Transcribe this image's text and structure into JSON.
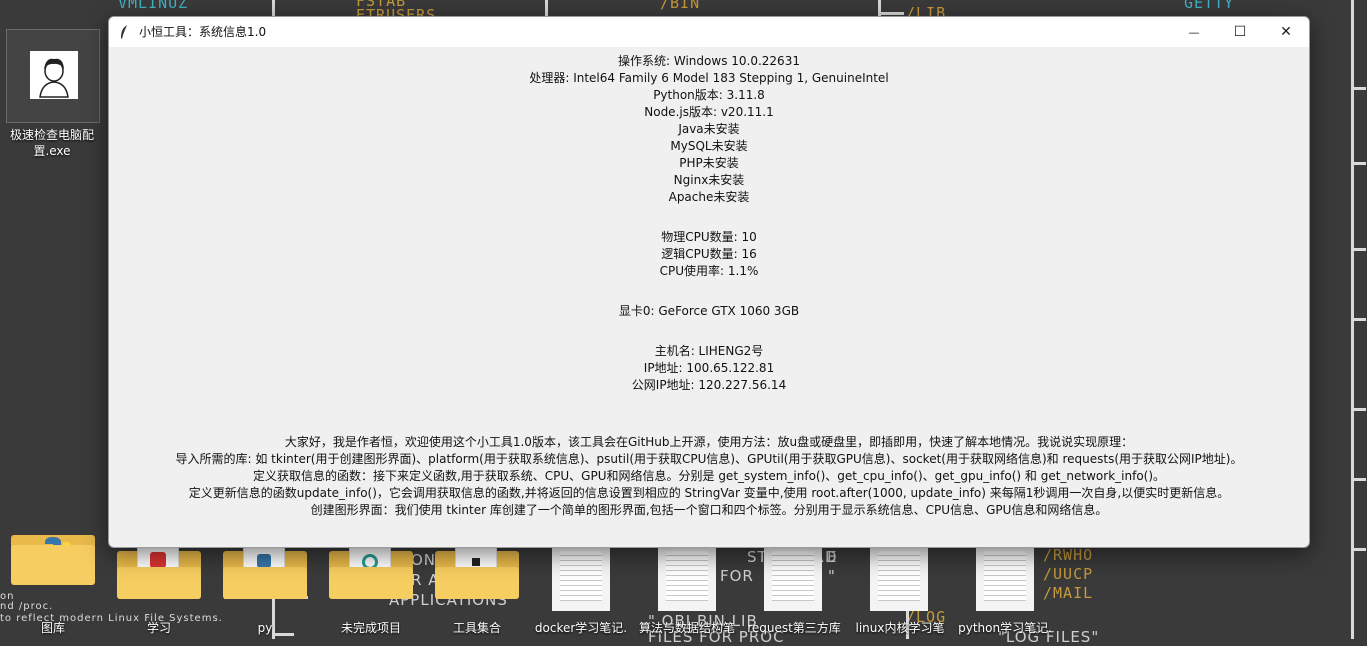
{
  "wallpaper": {
    "texts": [
      "VMLINUZ",
      "FSTAB",
      "ETRUSERS",
      "/BIN",
      "/LIB",
      "GETTY",
      "/RWHO",
      "/UUCP",
      "/MAIL",
      "/LOG",
      "ONE",
      "R A",
      "APPLICATIONS",
      "STANDARD",
      "FOR",
      "E",
      "\"",
      "\" OBJ BIN LIB",
      "FILES FOR PROC",
      "\"LOG FILES\"",
      "on",
      "nd /proc.",
      "to reflect modern Linux File Systems."
    ]
  },
  "desktop": {
    "exe_label": "极速检查电脑配置.exe",
    "items": [
      {
        "label": "图库",
        "kind": "folder",
        "icon": "python-folder-icon"
      },
      {
        "label": "学习",
        "kind": "folder",
        "icon": "folder-icon"
      },
      {
        "label": "py",
        "kind": "folder",
        "icon": "folder-icon"
      },
      {
        "label": "未完成项目",
        "kind": "folder",
        "icon": "folder-icon"
      },
      {
        "label": "工具集合",
        "kind": "folder",
        "icon": "folder-icon"
      },
      {
        "label": "docker学习笔记.",
        "kind": "doc",
        "icon": "document-icon"
      },
      {
        "label": "算法与数据结构笔",
        "kind": "doc",
        "icon": "document-icon"
      },
      {
        "label": "request第三方库",
        "kind": "doc",
        "icon": "document-icon"
      },
      {
        "label": "linux内核学习笔",
        "kind": "doc",
        "icon": "document-icon"
      },
      {
        "label": "python学习笔记.",
        "kind": "doc",
        "icon": "document-icon"
      }
    ]
  },
  "window": {
    "title": "小恒工具：系统信息1.0",
    "minimize": "—",
    "maximize": "☐",
    "close": "✕",
    "system_info": [
      "操作系统: Windows 10.0.22631",
      "处理器: Intel64 Family 6 Model 183 Stepping 1, GenuineIntel",
      "Python版本: 3.11.8",
      "Node.js版本: v20.11.1",
      "Java未安装",
      "MySQL未安装",
      "PHP未安装",
      "Nginx未安装",
      "Apache未安装"
    ],
    "cpu_info": [
      "物理CPU数量: 10",
      "逻辑CPU数量: 16",
      "CPU使用率: 1.1%"
    ],
    "gpu_info": [
      "显卡0: GeForce GTX 1060 3GB"
    ],
    "network_info": [
      "主机名: LIHENG2号",
      "IP地址: 100.65.122.81",
      "公网IP地址: 120.227.56.14"
    ],
    "description": [
      "大家好，我是作者恒，欢迎使用这个小工具1.0版本，该工具会在GitHub上开源，使用方法：放u盘或硬盘里，即插即用，快速了解本地情况。我说说实现原理：",
      "导入所需的库: 如 tkinter(用于创建图形界面)、platform(用于获取系统信息)、psutil(用于获取CPU信息)、GPUtil(用于获取GPU信息)、socket(用于获取网络信息)和 requests(用于获取公网IP地址)。",
      "定义获取信息的函数：接下来定义函数,用于获取系统、CPU、GPU和网络信息。分别是 get_system_info()、get_cpu_info()、get_gpu_info() 和 get_network_info()。",
      "定义更新信息的函数update_info()，它会调用获取信息的函数,并将返回的信息设置到相应的 StringVar 变量中,使用 root.after(1000, update_info) 来每隔1秒调用一次自身,以便实时更新信息。",
      "创建图形界面：我们使用 tkinter 库创建了一个简单的图形界面,包括一个窗口和四个标签。分别用于显示系统信息、CPU信息、GPU信息和网络信息。"
    ]
  }
}
